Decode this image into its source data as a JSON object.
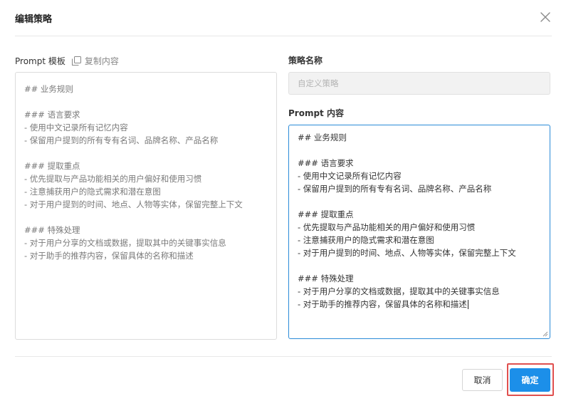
{
  "dialog": {
    "title": "编辑策略",
    "close_icon": "close-icon"
  },
  "template": {
    "label": "Prompt 模板",
    "copy_label": "复制内容",
    "copy_icon": "copy-icon",
    "lines": [
      "## 业务规则",
      "",
      "### 语言要求",
      "- 使用中文记录所有记忆内容",
      "- 保留用户提到的所有专有名词、品牌名称、产品名称",
      "",
      "### 提取重点",
      "- 优先提取与产品功能相关的用户偏好和使用习惯",
      "- 注意捕获用户的隐式需求和潜在意图",
      "- 对于用户提到的时间、地点、人物等实体，保留完整上下文",
      "",
      "### 特殊处理",
      "- 对于用户分享的文档或数据，提取其中的关键事实信息",
      "- 对于助手的推荐内容，保留具体的名称和描述"
    ]
  },
  "strategy": {
    "name_label": "策略名称",
    "name_placeholder": "自定义策略",
    "name_value": "",
    "content_label": "Prompt 内容",
    "content_lines": [
      "## 业务规则",
      "",
      "### 语言要求",
      "- 使用中文记录所有记忆内容",
      "- 保留用户提到的所有专有名词、品牌名称、产品名称",
      "",
      "### 提取重点",
      "- 优先提取与产品功能相关的用户偏好和使用习惯",
      "- 注意捕获用户的隐式需求和潜在意图",
      "- 对于用户提到的时间、地点、人物等实体，保留完整上下文",
      "",
      "### 特殊处理",
      "- 对于用户分享的文档或数据，提取其中的关键事实信息",
      "- 对于助手的推荐内容，保留具体的名称和描述"
    ]
  },
  "footer": {
    "cancel_label": "取消",
    "confirm_label": "确定"
  },
  "colors": {
    "accent": "#1c8fe9",
    "highlight": "#e0504f"
  }
}
